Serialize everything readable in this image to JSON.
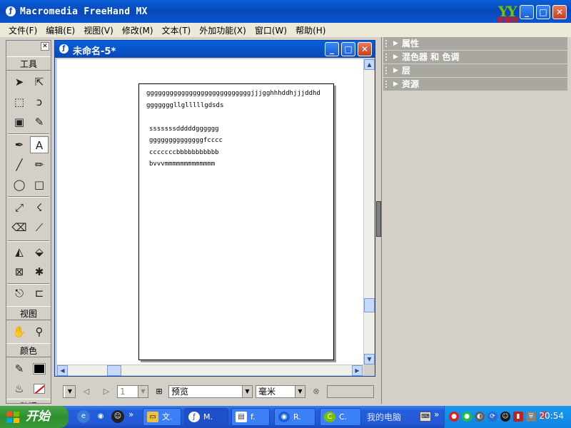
{
  "window": {
    "title": "Macromedia FreeHand MX",
    "logo_text": "育碟苑",
    "logo_mark": "YY"
  },
  "menu": [
    "文件(F)",
    "编辑(E)",
    "视图(V)",
    "修改(M)",
    "文本(T)",
    "外加功能(X)",
    "窗口(W)",
    "帮助(H)"
  ],
  "tools_panel": {
    "tools_header": "工具",
    "view_header": "视图",
    "color_header": "颜色",
    "bottom_header": "助理"
  },
  "document": {
    "title": "未命名-5*",
    "lines": [
      "gggggggggggggggggggggggggggjjjgghhhddhjjjddhd",
      "gggggggllglllllgdsds",
      "sssssssdddddgggggg",
      "ggggggggggggggfcccc",
      "cccccccbbbbbbbbbbb",
      "bvvvmmmmmmmmmmmmm"
    ]
  },
  "statusbar": {
    "page_value": "1",
    "view_mode": "预览",
    "units": "毫米"
  },
  "panels": [
    "属性",
    "混色器 和 色调",
    "层",
    "资源"
  ],
  "taskbar": {
    "start_label": "开始",
    "tasks": [
      "文.",
      "M.",
      "f.",
      "R.",
      "C."
    ],
    "my_computer": "我的电脑",
    "clock": "20:54",
    "expand_glyph": "»"
  },
  "colors": {
    "titlebar": "#0848b8",
    "accent_green": "#7ac000",
    "logo_red": "#d81818"
  }
}
